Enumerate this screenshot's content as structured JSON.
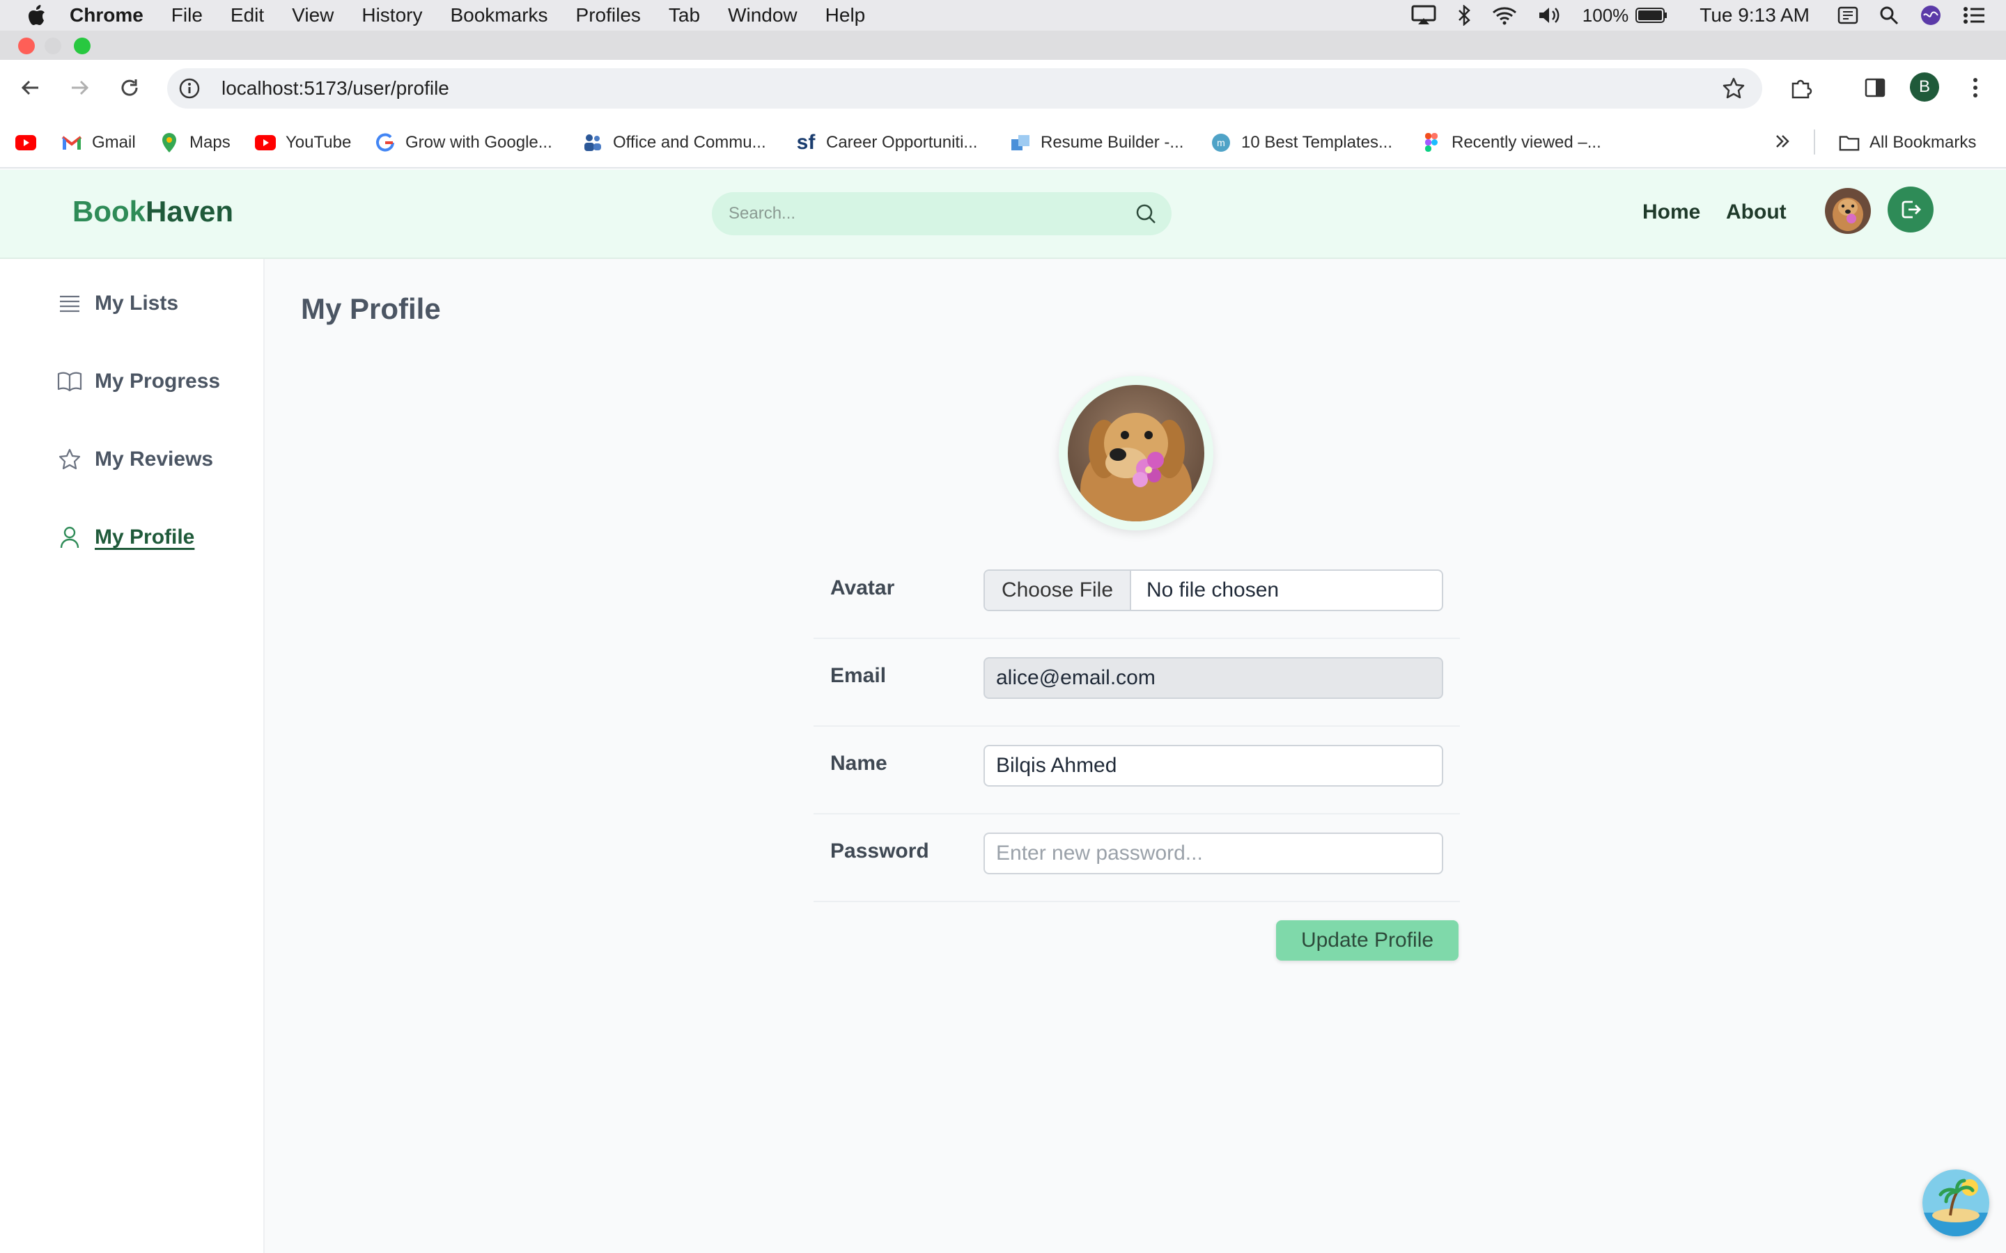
{
  "menubar": {
    "app": "Chrome",
    "items": [
      "File",
      "Edit",
      "View",
      "History",
      "Bookmarks",
      "Profiles",
      "Tab",
      "Window",
      "Help"
    ],
    "battery": "100%",
    "clock": "Tue 9:13 AM"
  },
  "browser": {
    "url": "localhost:5173/user/profile",
    "profile_initial": "B"
  },
  "bookmarks": {
    "items": [
      {
        "label": "Gmail",
        "icon": "gmail-icon"
      },
      {
        "label": "Maps",
        "icon": "maps-icon"
      },
      {
        "label": "YouTube",
        "icon": "youtube-icon"
      },
      {
        "label": "Grow with Google...",
        "icon": "google-icon"
      },
      {
        "label": "Office and Commu...",
        "icon": "office-icon"
      },
      {
        "label": "Career Opportuniti...",
        "icon": "sf-icon"
      },
      {
        "label": "Resume Builder -...",
        "icon": "resume-icon"
      },
      {
        "label": "10 Best Templates...",
        "icon": "m-icon"
      },
      {
        "label": "Recently viewed –...",
        "icon": "figma-icon"
      }
    ],
    "all_bookmarks": "All Bookmarks"
  },
  "header": {
    "logo_part1": "Book",
    "logo_part2": "Haven",
    "search_placeholder": "Search...",
    "nav": {
      "home": "Home",
      "about": "About"
    }
  },
  "sidebar": {
    "items": [
      {
        "label": "My Lists",
        "icon": "list-icon"
      },
      {
        "label": "My Progress",
        "icon": "book-open-icon"
      },
      {
        "label": "My Reviews",
        "icon": "star-icon"
      },
      {
        "label": "My Profile",
        "icon": "user-icon",
        "active": true
      }
    ]
  },
  "main": {
    "title": "My Profile",
    "form": {
      "avatar_label": "Avatar",
      "choose_file": "Choose File",
      "no_file": "No file chosen",
      "email_label": "Email",
      "email_value": "alice@email.com",
      "name_label": "Name",
      "name_value": "Bilqis Ahmed",
      "password_label": "Password",
      "password_placeholder": "Enter new password..."
    },
    "update_button": "Update Profile"
  },
  "colors": {
    "brand": "#2e8b57",
    "brand_dark": "#1f5a3a",
    "header_bg": "#ecfbf3",
    "button_bg": "#7fd9aa"
  }
}
